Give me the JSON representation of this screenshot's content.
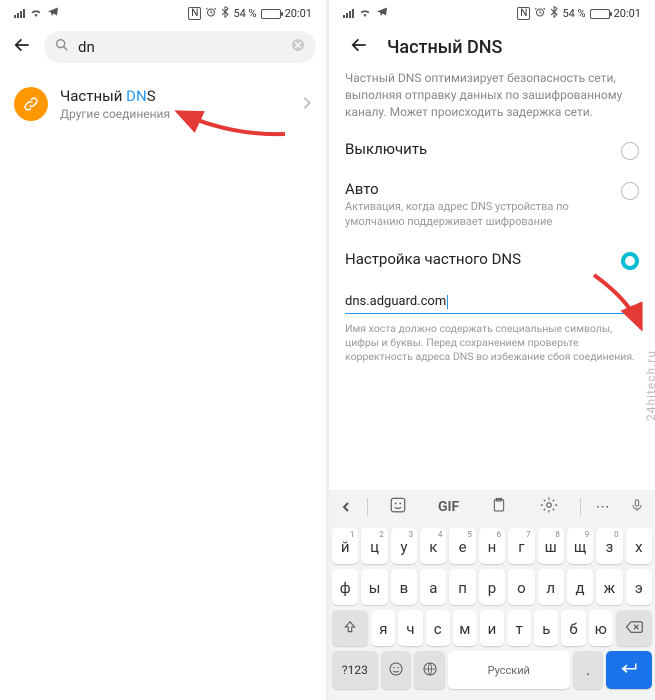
{
  "status": {
    "nfc": "ℕ",
    "alarm": "⏰",
    "bt": "54 %",
    "time": "20:01"
  },
  "left": {
    "search_value": "dn",
    "result_title_prefix": "Частный ",
    "result_title_hl": "DN",
    "result_title_suffix": "S",
    "result_sub": "Другие соединения"
  },
  "right": {
    "title": "Частный DNS",
    "description": "Частный DNS оптимизирует безопасность сети, выполняя отправку данных по зашифрованному каналу. Может происходить задержка сети.",
    "opt_off": "Выключить",
    "opt_auto": "Авто",
    "opt_auto_sub": "Активация, когда адрес DNS устройства по умолчанию поддерживает шифрование",
    "opt_custom": "Настройка частного DNS",
    "dns_value": "dns.adguard.com",
    "hint": "Имя хоста должно содержать специальные символы, цифры и буквы. Перед сохранением проверьте корректность адреса DNS во избежание сбоя соединения."
  },
  "keyboard": {
    "gif": "GIF",
    "row1": [
      "й",
      "ц",
      "у",
      "к",
      "е",
      "н",
      "г",
      "ш",
      "щ",
      "з",
      "х"
    ],
    "nums1": [
      "1",
      "2",
      "3",
      "4",
      "5",
      "6",
      "7",
      "8",
      "9",
      "0",
      ""
    ],
    "row2": [
      "ф",
      "ы",
      "в",
      "а",
      "п",
      "р",
      "о",
      "л",
      "д",
      "ж",
      "э"
    ],
    "row3": [
      "я",
      "ч",
      "с",
      "м",
      "и",
      "т",
      "ь",
      "б",
      "ю"
    ],
    "sym": "?123",
    "lang": "Русский"
  },
  "watermark": "24hitech.ru"
}
